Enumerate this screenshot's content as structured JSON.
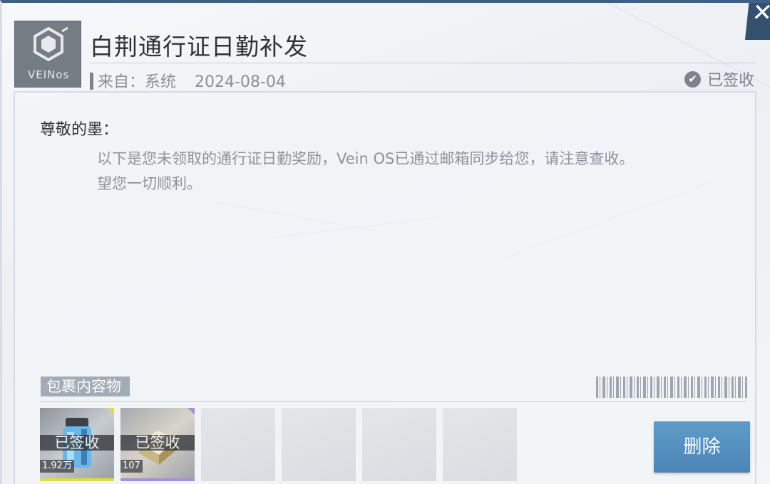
{
  "mail": {
    "title": "白荆通行证日勤补发",
    "sender": "来自：系统",
    "date": "2024-08-04",
    "status": "已签收",
    "greeting": "尊敬的墨：",
    "body_line1": "以下是您未领取的通行证日勤奖励，Vein OS已通过邮箱同步给您，请注意查收。",
    "body_line2": "望您一切顺利。"
  },
  "logo": {
    "text": "VEINos",
    "icon": "vein-os-logo"
  },
  "attachments": {
    "label": "包裹内容物",
    "items": [
      {
        "stamp": "已签收",
        "quantity": "1.92万",
        "rarity_color": "#e7d647",
        "icon": "energy-canister-icon"
      },
      {
        "stamp": "已签收",
        "quantity": "107",
        "rarity_color": "#a88ee0",
        "icon": "material-crate-icon"
      }
    ],
    "empty_slots": 4
  },
  "actions": {
    "delete_label": "删除",
    "close_icon": "close-icon"
  }
}
